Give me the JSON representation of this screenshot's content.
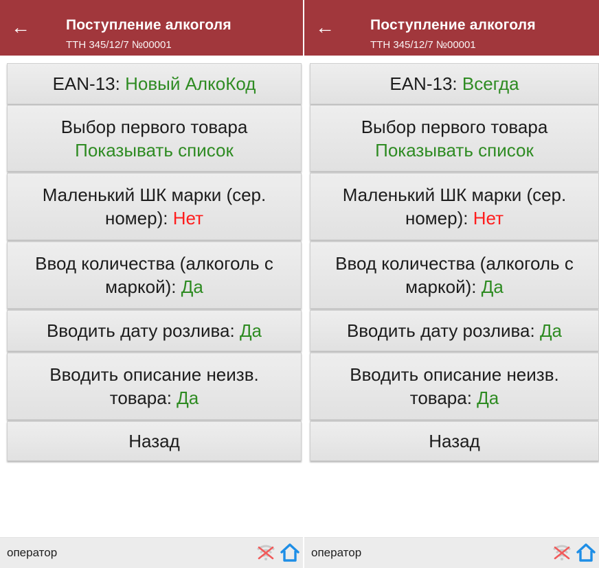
{
  "colors": {
    "appbar": "#a1373c",
    "green_value": "#2e8b22",
    "red_value": "#ff1d1d",
    "home_icon": "#1e8ee6"
  },
  "screens": [
    {
      "title": "Поступление алкоголя",
      "subtitle": "ТТН 345/12/7 №00001",
      "back_icon": "arrow-left-icon",
      "buttons": [
        {
          "label": "EAN-13:",
          "value": "Новый АлкоКод"
        },
        {
          "label": "Выбор первого товара",
          "value": "Показывать список"
        },
        {
          "label_line1": "Маленький ШК марки (сер.",
          "label_line2": "номер):",
          "value": "Нет"
        },
        {
          "label_line1": "Ввод количества (алкоголь с",
          "label_line2": "маркой):",
          "value": "Да"
        },
        {
          "label": "Вводить дату розлива:",
          "value": "Да"
        },
        {
          "label_line1": "Вводить описание неизв.",
          "label_line2": "товара:",
          "value": "Да"
        },
        {
          "label": "Назад"
        }
      ],
      "status": {
        "operator": "оператор",
        "icons": [
          "wifi-off-icon",
          "home-icon"
        ]
      }
    },
    {
      "title": "Поступление алкоголя",
      "subtitle": "ТТН 345/12/7 №00001",
      "back_icon": "arrow-left-icon",
      "buttons": [
        {
          "label": "EAN-13:",
          "value": "Всегда"
        },
        {
          "label": "Выбор первого товара",
          "value": "Показывать список"
        },
        {
          "label_line1": "Маленький ШК марки (сер.",
          "label_line2": "номер):",
          "value": "Нет"
        },
        {
          "label_line1": "Ввод количества (алкоголь с",
          "label_line2": "маркой):",
          "value": "Да"
        },
        {
          "label": "Вводить дату розлива:",
          "value": "Да"
        },
        {
          "label_line1": "Вводить описание неизв.",
          "label_line2": "товара:",
          "value": "Да"
        },
        {
          "label": "Назад"
        }
      ],
      "status": {
        "operator": "оператор",
        "icons": [
          "wifi-off-icon",
          "home-icon"
        ]
      }
    }
  ]
}
